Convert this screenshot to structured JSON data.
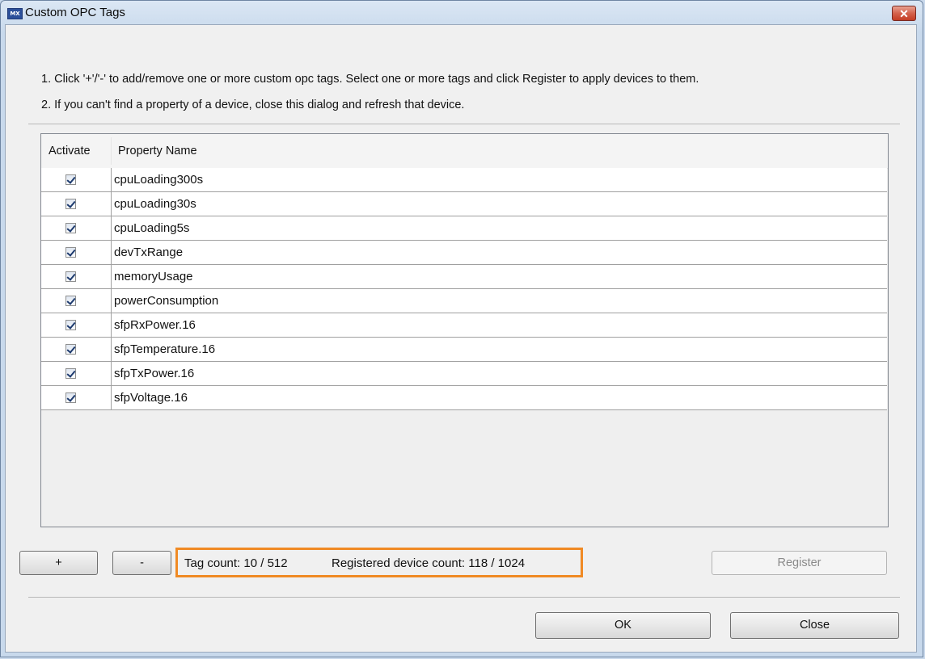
{
  "window": {
    "title": "Custom OPC Tags",
    "close_symbol": "✕",
    "app_icon_text": "MX"
  },
  "instructions": [
    "1. Click '+'/'-' to add/remove one or more custom opc tags. Select one or more tags and click Register to apply devices to them.",
    "2. If you can't find a property of a device, close this dialog and refresh that device."
  ],
  "table": {
    "columns": [
      "Activate",
      "Property Name"
    ],
    "rows": [
      {
        "activate": true,
        "name": "cpuLoading300s"
      },
      {
        "activate": true,
        "name": "cpuLoading30s"
      },
      {
        "activate": true,
        "name": "cpuLoading5s"
      },
      {
        "activate": true,
        "name": "devTxRange"
      },
      {
        "activate": true,
        "name": "memoryUsage"
      },
      {
        "activate": true,
        "name": "powerConsumption"
      },
      {
        "activate": true,
        "name": "sfpRxPower.16"
      },
      {
        "activate": true,
        "name": "sfpTemperature.16"
      },
      {
        "activate": true,
        "name": "sfpTxPower.16"
      },
      {
        "activate": true,
        "name": "sfpVoltage.16"
      }
    ]
  },
  "controls": {
    "add_label": "+",
    "remove_label": "-",
    "tag_count": "Tag count:  10 / 512",
    "device_count": "Registered device count:  118 / 1024",
    "register_label": "Register",
    "highlight_color": "#f08a24"
  },
  "footer": {
    "ok_label": "OK",
    "close_label": "Close"
  }
}
